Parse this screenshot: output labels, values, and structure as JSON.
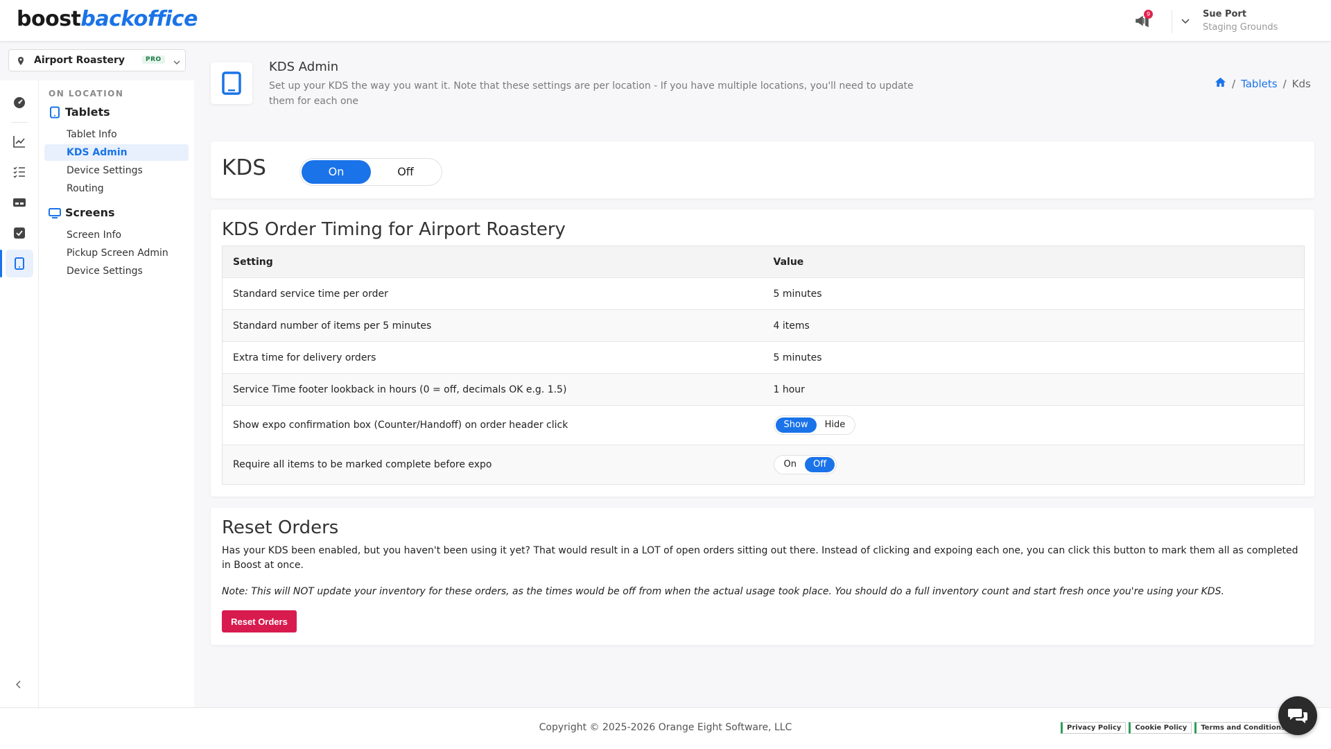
{
  "brand": {
    "logo_part1": "boost",
    "logo_part2": "backoffice",
    "accent": "#1a73e8",
    "danger": "#d81b4f"
  },
  "header": {
    "notification_count": "9",
    "user_name": "Sue Port",
    "user_site": "Staging Grounds"
  },
  "location": {
    "name": "Airport Roastery",
    "badge": "PRO"
  },
  "rail": {
    "icons": [
      "dashboard-icon",
      "chart-line-icon",
      "checklist-icon",
      "card-icon",
      "checkbox-icon",
      "tablet-icon"
    ],
    "active": "tablet-icon"
  },
  "subnav": {
    "heading": "ON LOCATION",
    "groups": [
      {
        "title": "Tablets",
        "items": [
          "Tablet Info",
          "KDS Admin",
          "Device Settings",
          "Routing"
        ]
      },
      {
        "title": "Screens",
        "items": [
          "Screen Info",
          "Pickup Screen Admin",
          "Device Settings"
        ]
      }
    ],
    "active_item": "KDS Admin"
  },
  "page": {
    "title": "KDS Admin",
    "description": "Set up your KDS the way you want it. Note that these settings are per location - If you have multiple locations, you'll need to update them for each one",
    "breadcrumb": {
      "parent": "Tablets",
      "current": "Kds",
      "separator": "/"
    }
  },
  "kds": {
    "label": "KDS",
    "on_label": "On",
    "off_label": "Off",
    "selected": "On"
  },
  "timing": {
    "title": "KDS Order Timing for Airport Roastery",
    "columns": [
      "Setting",
      "Value"
    ],
    "rows": [
      {
        "setting": "Standard service time per order",
        "value": "5 minutes"
      },
      {
        "setting": "Standard number of items per 5 minutes",
        "value": "4 items"
      },
      {
        "setting": "Extra time for delivery orders",
        "value": "5 minutes"
      },
      {
        "setting": "Service Time footer lookback in hours (0 = off, decimals OK e.g. 1.5)",
        "value": "1 hour"
      }
    ],
    "expo_row": {
      "setting": "Show expo confirmation box (Counter/Handoff) on order header click",
      "show_label": "Show",
      "hide_label": "Hide",
      "selected": "Show"
    },
    "complete_row": {
      "setting": "Require all items to be marked complete before expo",
      "on_label": "On",
      "off_label": "Off",
      "selected": "Off"
    }
  },
  "reset": {
    "title": "Reset Orders",
    "text": "Has your KDS been enabled, but you haven't been using it yet? That would result in a LOT of open orders sitting out there. Instead of clicking and expoing each one, you can click this button to mark them all as completed in Boost at once.",
    "note": "Note: This will NOT update your inventory for these orders, as the times would be off from when the actual usage took place. You should do a full inventory count and start fresh once you're using your KDS.",
    "button": "Reset Orders"
  },
  "footer": {
    "copyright": "Copyright © 2025-2026 Orange Eight Software, LLC",
    "links": [
      "Privacy Policy",
      "Cookie Policy",
      "Terms and Conditions"
    ]
  }
}
